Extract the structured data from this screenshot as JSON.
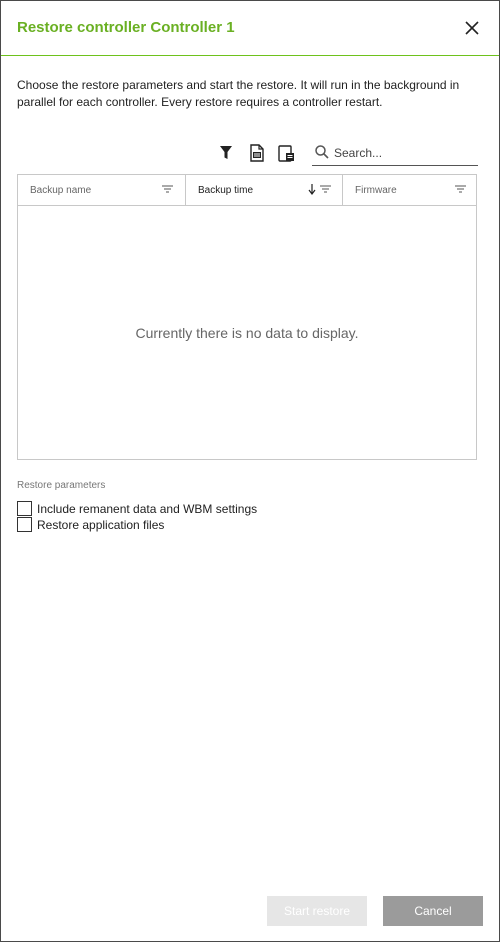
{
  "dialog": {
    "title": "Restore controller Controller 1",
    "close_icon": "close-icon",
    "description": "Choose the restore parameters and start the restore. It will run in the background in parallel for each controller. Every restore requires a controller restart."
  },
  "toolbar": {
    "icons": [
      "filter-icon",
      "export-csv-icon",
      "column-settings-icon"
    ],
    "search_placeholder": "Search..."
  },
  "grid": {
    "columns": [
      {
        "label": "Backup name",
        "sort": "",
        "filter_icon": "filter-lines-icon"
      },
      {
        "label": "Backup time",
        "sort": "descending",
        "filter_icon": "filter-lines-icon"
      },
      {
        "label": "Firmware",
        "sort": "",
        "filter_icon": "filter-lines-icon"
      }
    ],
    "rows": [],
    "empty_message": "Currently there is no data to display."
  },
  "restore_parameters": {
    "label": "Restore parameters",
    "options": [
      {
        "label": "Include remanent data and WBM settings",
        "checked": false
      },
      {
        "label": "Restore application files",
        "checked": false
      }
    ]
  },
  "footer": {
    "start_label": "Start restore",
    "start_enabled": false,
    "cancel_label": "Cancel"
  },
  "colors": {
    "title": "#6ab023",
    "header_rule": "#6ec21c",
    "button_disabled": "#e6e6e6",
    "button_cancel": "#9b9b9b"
  }
}
